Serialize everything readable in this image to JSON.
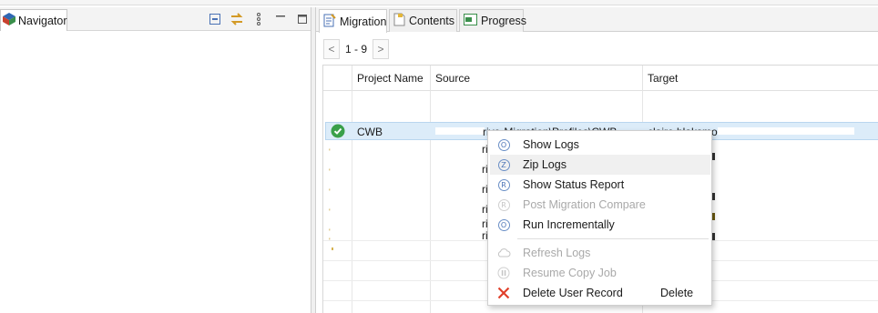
{
  "navigator": {
    "tab_label": "Navigator",
    "tools": [
      "collapse-all-icon",
      "link-with-editor-icon",
      "view-menu-icon",
      "minimize-icon",
      "maximize-icon"
    ]
  },
  "editor": {
    "tabs": [
      {
        "label": "Migration",
        "icon": "migration-icon",
        "active": true
      },
      {
        "label": "Contents",
        "icon": "contents-icon",
        "active": false
      },
      {
        "label": "Progress",
        "icon": "progress-icon",
        "active": false
      }
    ],
    "pager": {
      "prev": "<",
      "range": "1 - 9",
      "next": ">"
    }
  },
  "grid": {
    "columns": [
      "Project Name",
      "Source",
      "Target"
    ],
    "selected_row": {
      "status_icon": "success-check-icon",
      "project_name": "CWB",
      "source": "rive-Migration\\Profiles\\CWB",
      "target": "claire.blaksmo"
    },
    "partial_rows": [
      "ri",
      "ri",
      "ri",
      "ri",
      "ri",
      "ri"
    ]
  },
  "context_menu": {
    "items": [
      {
        "label": "Show Logs",
        "icon": "show-logs-icon",
        "enabled": true,
        "icon_letter": "O"
      },
      {
        "label": "Zip Logs",
        "icon": "zip-logs-icon",
        "enabled": true,
        "icon_letter": "Z"
      },
      {
        "label": "Show Status Report",
        "icon": "status-report-icon",
        "enabled": true,
        "icon_letter": "R"
      },
      {
        "label": "Post Migration Compare",
        "icon": "compare-icon",
        "enabled": false,
        "icon_letter": "R"
      },
      {
        "label": "Run Incrementally",
        "icon": "run-incrementally-icon",
        "enabled": true,
        "icon_letter": "O"
      },
      {
        "label": "Refresh Logs",
        "icon": "cloud-icon",
        "enabled": false
      },
      {
        "label": "Resume Copy Job",
        "icon": "pause-icon",
        "enabled": false
      },
      {
        "label": "Delete User Record",
        "icon": "delete-icon",
        "enabled": true,
        "accelerator": "Delete"
      }
    ]
  },
  "colors": {
    "accent_blue": "#4a72b5",
    "delete_red": "#e0402b",
    "success_green": "#3aa04a",
    "selection": "#dcecf9"
  }
}
